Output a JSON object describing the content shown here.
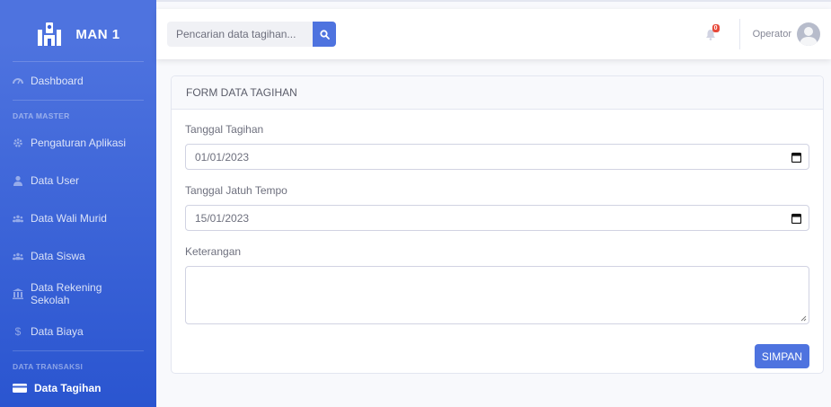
{
  "brand": {
    "name": "MAN 1"
  },
  "sidebar": {
    "dashboard": "Dashboard",
    "heading_master": "DATA MASTER",
    "items_master": [
      {
        "label": "Pengaturan Aplikasi",
        "icon": "gear-icon"
      },
      {
        "label": "Data User",
        "icon": "user-icon"
      },
      {
        "label": "Data Wali Murid",
        "icon": "users-icon"
      },
      {
        "label": "Data Siswa",
        "icon": "users-icon"
      },
      {
        "label": "Data Rekening Sekolah",
        "icon": "bank-icon"
      },
      {
        "label": "Data Biaya",
        "icon": "dollar-icon"
      }
    ],
    "heading_transaksi": "DATA TRANSAKSI",
    "active_item": "Data Tagihan"
  },
  "topbar": {
    "search_placeholder": "Pencarian data tagihan...",
    "notification_count": "0",
    "user_name": "Operator"
  },
  "form": {
    "title": "FORM DATA TAGIHAN",
    "tanggal_tagihan_label": "Tanggal Tagihan",
    "tanggal_tagihan_value": "01/01/2023",
    "jatuh_tempo_label": "Tanggal Jatuh Tempo",
    "jatuh_tempo_value": "15/01/2023",
    "keterangan_label": "Keterangan",
    "keterangan_value": "",
    "save_label": "SIMPAN"
  },
  "colors": {
    "primary": "#4e73df",
    "badge": "#e74a3b",
    "background": "#f8f9fc"
  }
}
